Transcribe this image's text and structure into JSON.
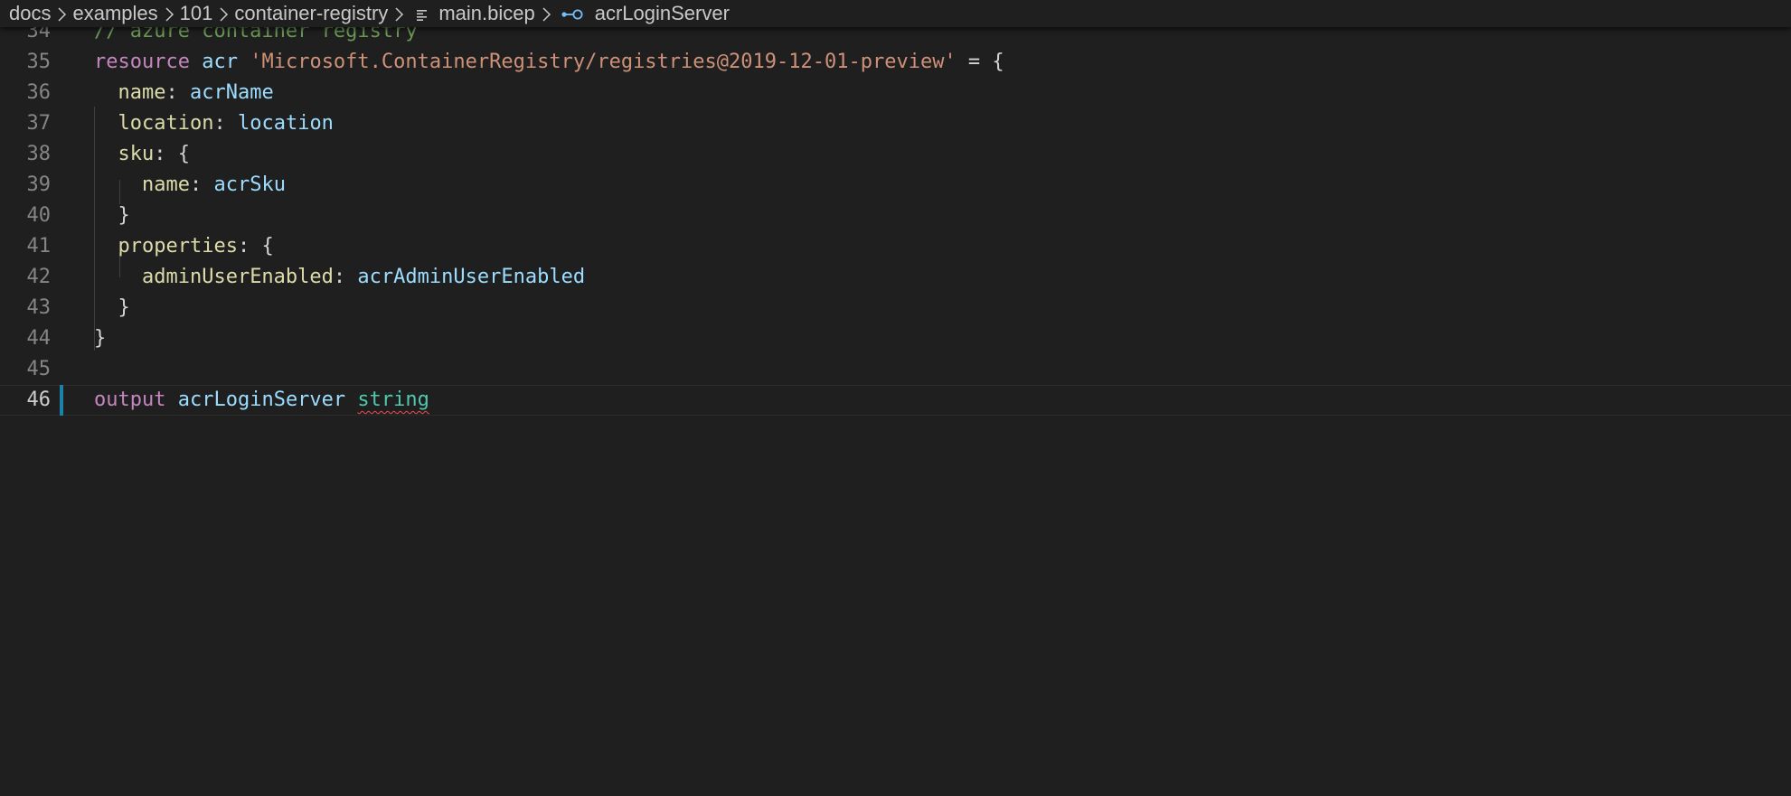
{
  "breadcrumb": {
    "items": [
      "docs",
      "examples",
      "101",
      "container-registry"
    ],
    "file": "main.bicep",
    "symbol": "acrLoginServer",
    "file_icon": "file-lines-icon",
    "symbol_icon": "symbol-field-icon"
  },
  "editor": {
    "current_line": "46",
    "lines": [
      {
        "number": "34",
        "tokens": [
          {
            "t": "// azure container registry",
            "k": "cmt"
          }
        ]
      },
      {
        "number": "35",
        "tokens": [
          {
            "t": "resource",
            "k": "kw"
          },
          {
            "t": " ",
            "k": "punc"
          },
          {
            "t": "acr",
            "k": "id"
          },
          {
            "t": " ",
            "k": "punc"
          },
          {
            "t": "'Microsoft.ContainerRegistry/registries@2019-12-01-preview'",
            "k": "str"
          },
          {
            "t": " = {",
            "k": "punc"
          }
        ]
      },
      {
        "number": "36",
        "tokens": [
          {
            "t": "  ",
            "k": "punc"
          },
          {
            "t": "name",
            "k": "prop"
          },
          {
            "t": ": ",
            "k": "punc"
          },
          {
            "t": "acrName",
            "k": "id"
          }
        ]
      },
      {
        "number": "37",
        "tokens": [
          {
            "t": "  ",
            "k": "punc"
          },
          {
            "t": "location",
            "k": "prop"
          },
          {
            "t": ": ",
            "k": "punc"
          },
          {
            "t": "location",
            "k": "id"
          }
        ]
      },
      {
        "number": "38",
        "tokens": [
          {
            "t": "  ",
            "k": "punc"
          },
          {
            "t": "sku",
            "k": "prop"
          },
          {
            "t": ": {",
            "k": "punc"
          }
        ]
      },
      {
        "number": "39",
        "tokens": [
          {
            "t": "    ",
            "k": "punc"
          },
          {
            "t": "name",
            "k": "prop"
          },
          {
            "t": ": ",
            "k": "punc"
          },
          {
            "t": "acrSku",
            "k": "id"
          }
        ]
      },
      {
        "number": "40",
        "tokens": [
          {
            "t": "  }",
            "k": "punc"
          }
        ]
      },
      {
        "number": "41",
        "tokens": [
          {
            "t": "  ",
            "k": "punc"
          },
          {
            "t": "properties",
            "k": "prop"
          },
          {
            "t": ": {",
            "k": "punc"
          }
        ]
      },
      {
        "number": "42",
        "tokens": [
          {
            "t": "    ",
            "k": "punc"
          },
          {
            "t": "adminUserEnabled",
            "k": "prop"
          },
          {
            "t": ": ",
            "k": "punc"
          },
          {
            "t": "acrAdminUserEnabled",
            "k": "id"
          }
        ]
      },
      {
        "number": "43",
        "tokens": [
          {
            "t": "  }",
            "k": "punc"
          }
        ]
      },
      {
        "number": "44",
        "tokens": [
          {
            "t": "}",
            "k": "punc"
          }
        ]
      },
      {
        "number": "45",
        "tokens": []
      },
      {
        "number": "46",
        "tokens": [
          {
            "t": "output",
            "k": "kw"
          },
          {
            "t": " ",
            "k": "punc"
          },
          {
            "t": "acrLoginServer",
            "k": "id"
          },
          {
            "t": " ",
            "k": "punc"
          },
          {
            "t": "string",
            "k": "type",
            "error": true
          }
        ]
      }
    ]
  }
}
